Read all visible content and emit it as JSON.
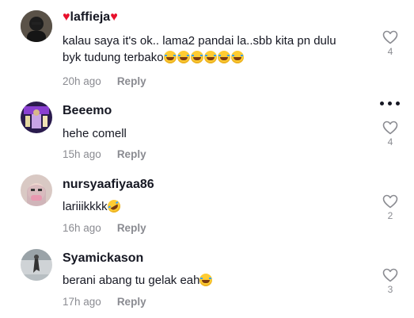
{
  "comments": [
    {
      "username": "laffieja",
      "text_line1": "kalau saya it's ok.. lama2 pandai la..sbb kita pn dulu",
      "text_line2": "byk tudung terbako",
      "time": "20h ago",
      "reply_label": "Reply",
      "likes": "4"
    },
    {
      "username": "Beeemo",
      "text": "hehe comell",
      "time": "15h ago",
      "reply_label": "Reply",
      "likes": "4"
    },
    {
      "username": "nursyaafiyaa86",
      "text": "lariiikkkk",
      "time": "16h ago",
      "reply_label": "Reply",
      "likes": "2"
    },
    {
      "username": "Syamickason",
      "text": "berani abang tu gelak eah",
      "time": "17h ago",
      "reply_label": "Reply",
      "likes": "3"
    }
  ],
  "colors": {
    "text": "#161823",
    "muted": "#8a8b91",
    "heart": "#e8102c"
  }
}
